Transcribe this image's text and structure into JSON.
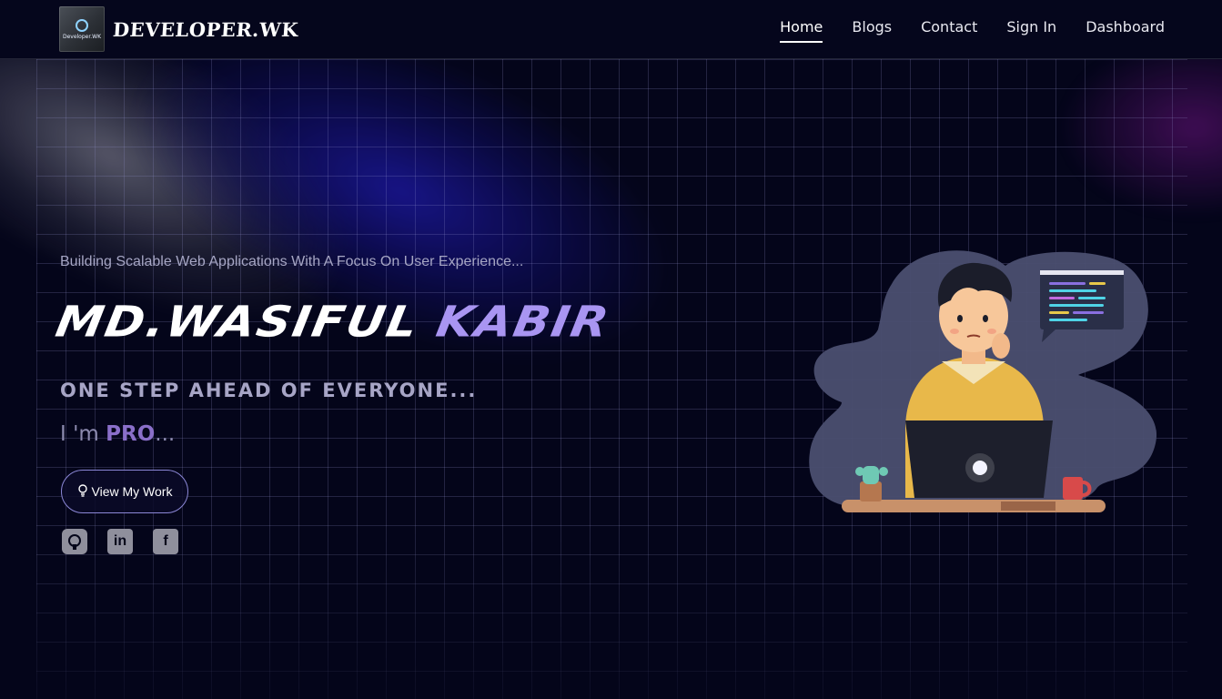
{
  "brand": {
    "name": "DEVELOPER.WK",
    "logo_text": "Developer.WK"
  },
  "nav": {
    "items": [
      {
        "label": "Home",
        "active": true
      },
      {
        "label": "Blogs",
        "active": false
      },
      {
        "label": "Contact",
        "active": false
      },
      {
        "label": "Sign In",
        "active": false
      },
      {
        "label": "Dashboard",
        "active": false
      }
    ]
  },
  "hero": {
    "tagline": "Building Scalable Web Applications With A Focus On User Experience...",
    "name_first": "MD.WASIFUL ",
    "name_accent": "KABIR",
    "slogan": "ONE STEP AHEAD OF EVERYONE...",
    "role_prefix": "I 'm ",
    "role_strong": "PRO",
    "role_suffix": "...",
    "cta_label": "View My Work",
    "cta_icon": "lightbulb-icon"
  },
  "socials": [
    {
      "name": "github-icon"
    },
    {
      "name": "linkedin-icon",
      "glyph": "in"
    },
    {
      "name": "facebook-icon",
      "glyph": "f"
    }
  ],
  "colors": {
    "background": "#04051a",
    "accent_purple": "#a995f2",
    "button_border": "#8b87d6",
    "muted_text": "#a6a6c4"
  }
}
